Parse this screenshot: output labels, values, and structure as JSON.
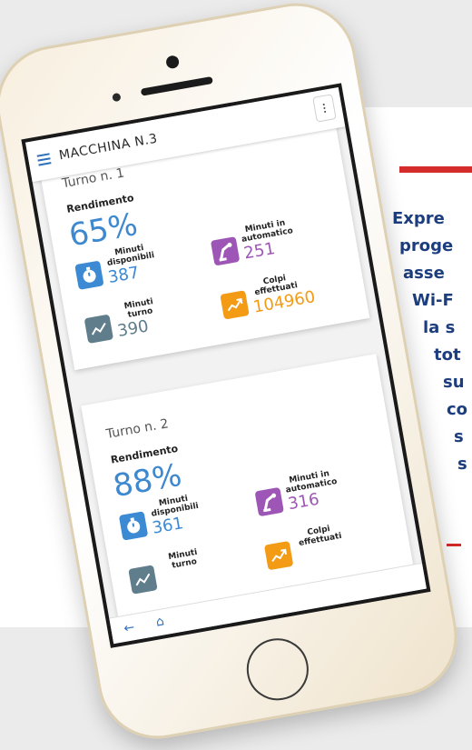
{
  "side_text": {
    "lines": [
      "Expre",
      "proge",
      "asse",
      "Wi-F",
      "la s",
      "tot",
      "su",
      "co",
      "s",
      "s"
    ]
  },
  "app": {
    "title": "MACCHINA N.3",
    "menu_icon": "hamburger-menu-icon",
    "more_icon": "more-vertical-icon"
  },
  "shifts": [
    {
      "name": "Turno n. 1",
      "yield_label": "Rendimento",
      "yield_value": "65%",
      "metrics": [
        {
          "label": "Minuti disponibili",
          "value": "387",
          "icon": "stopwatch-icon",
          "color": "#3c8ad3"
        },
        {
          "label": "Minuti in automatico",
          "value": "251",
          "icon": "robot-arm-icon",
          "color": "#9d56b5"
        },
        {
          "label": "Minuti turno",
          "value": "390",
          "icon": "trend-line-icon",
          "color": "#607d8b"
        },
        {
          "label": "Colpi effettuati",
          "value": "104960",
          "icon": "trend-up-icon",
          "color": "#f39b14"
        }
      ]
    },
    {
      "name": "Turno n. 2",
      "yield_label": "Rendimento",
      "yield_value": "88%",
      "metrics": [
        {
          "label": "Minuti disponibili",
          "value": "361",
          "icon": "stopwatch-icon",
          "color": "#3c8ad3"
        },
        {
          "label": "Minuti in automatico",
          "value": "316",
          "icon": "robot-arm-icon",
          "color": "#9d56b5"
        },
        {
          "label": "Minuti turno",
          "value": "",
          "icon": "trend-line-icon",
          "color": "#607d8b"
        },
        {
          "label": "Colpi effettuati",
          "value": "",
          "icon": "trend-up-icon",
          "color": "#f39b14"
        }
      ]
    }
  ],
  "bottom_nav": {
    "back_icon": "back-arrow-icon",
    "home_icon": "home-icon"
  },
  "colors": {
    "accent": "#d42b2b",
    "text_blue": "#1c3d7e",
    "app_blue": "#3d88cf"
  }
}
